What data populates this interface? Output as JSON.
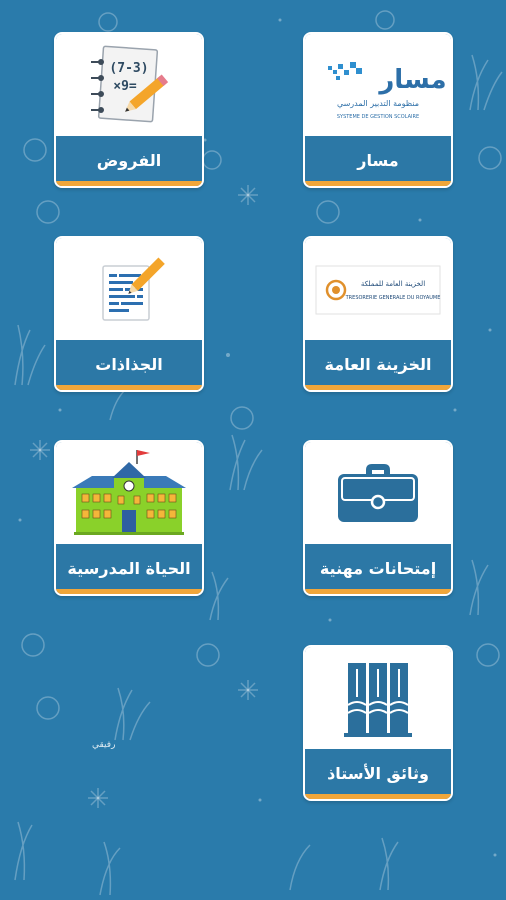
{
  "tiles": [
    {
      "label": "مسار",
      "icon": "massar-logo-icon",
      "logo_title": "مسار",
      "logo_subtitle": "منظومة التدبير المدرسي",
      "logo_caption": "SYSTEME DE GESTION SCOLAIRE"
    },
    {
      "label": "الفروض",
      "icon": "notebook-math-icon",
      "math_text_1": "(7-3)",
      "math_text_2": "×9="
    },
    {
      "label": "الخزينة العامة",
      "icon": "treasury-logo-icon",
      "logo_title": "الخزينة العامة للمملكة",
      "logo_caption": "TRESORERIE GENERALE DU ROYAUME"
    },
    {
      "label": "الجذاذات",
      "icon": "document-pencil-icon"
    },
    {
      "label": "إمتحانات مهنية",
      "icon": "briefcase-icon"
    },
    {
      "label": "الحياة المدرسية",
      "icon": "school-building-icon"
    },
    {
      "label": "وثائق الأستاذ",
      "icon": "books-icon"
    }
  ],
  "footer_text": "رفيقي",
  "colors": {
    "background": "#2a7bab",
    "accent_bar": "#f0a63a",
    "icon_blue": "#2b6f9c"
  }
}
